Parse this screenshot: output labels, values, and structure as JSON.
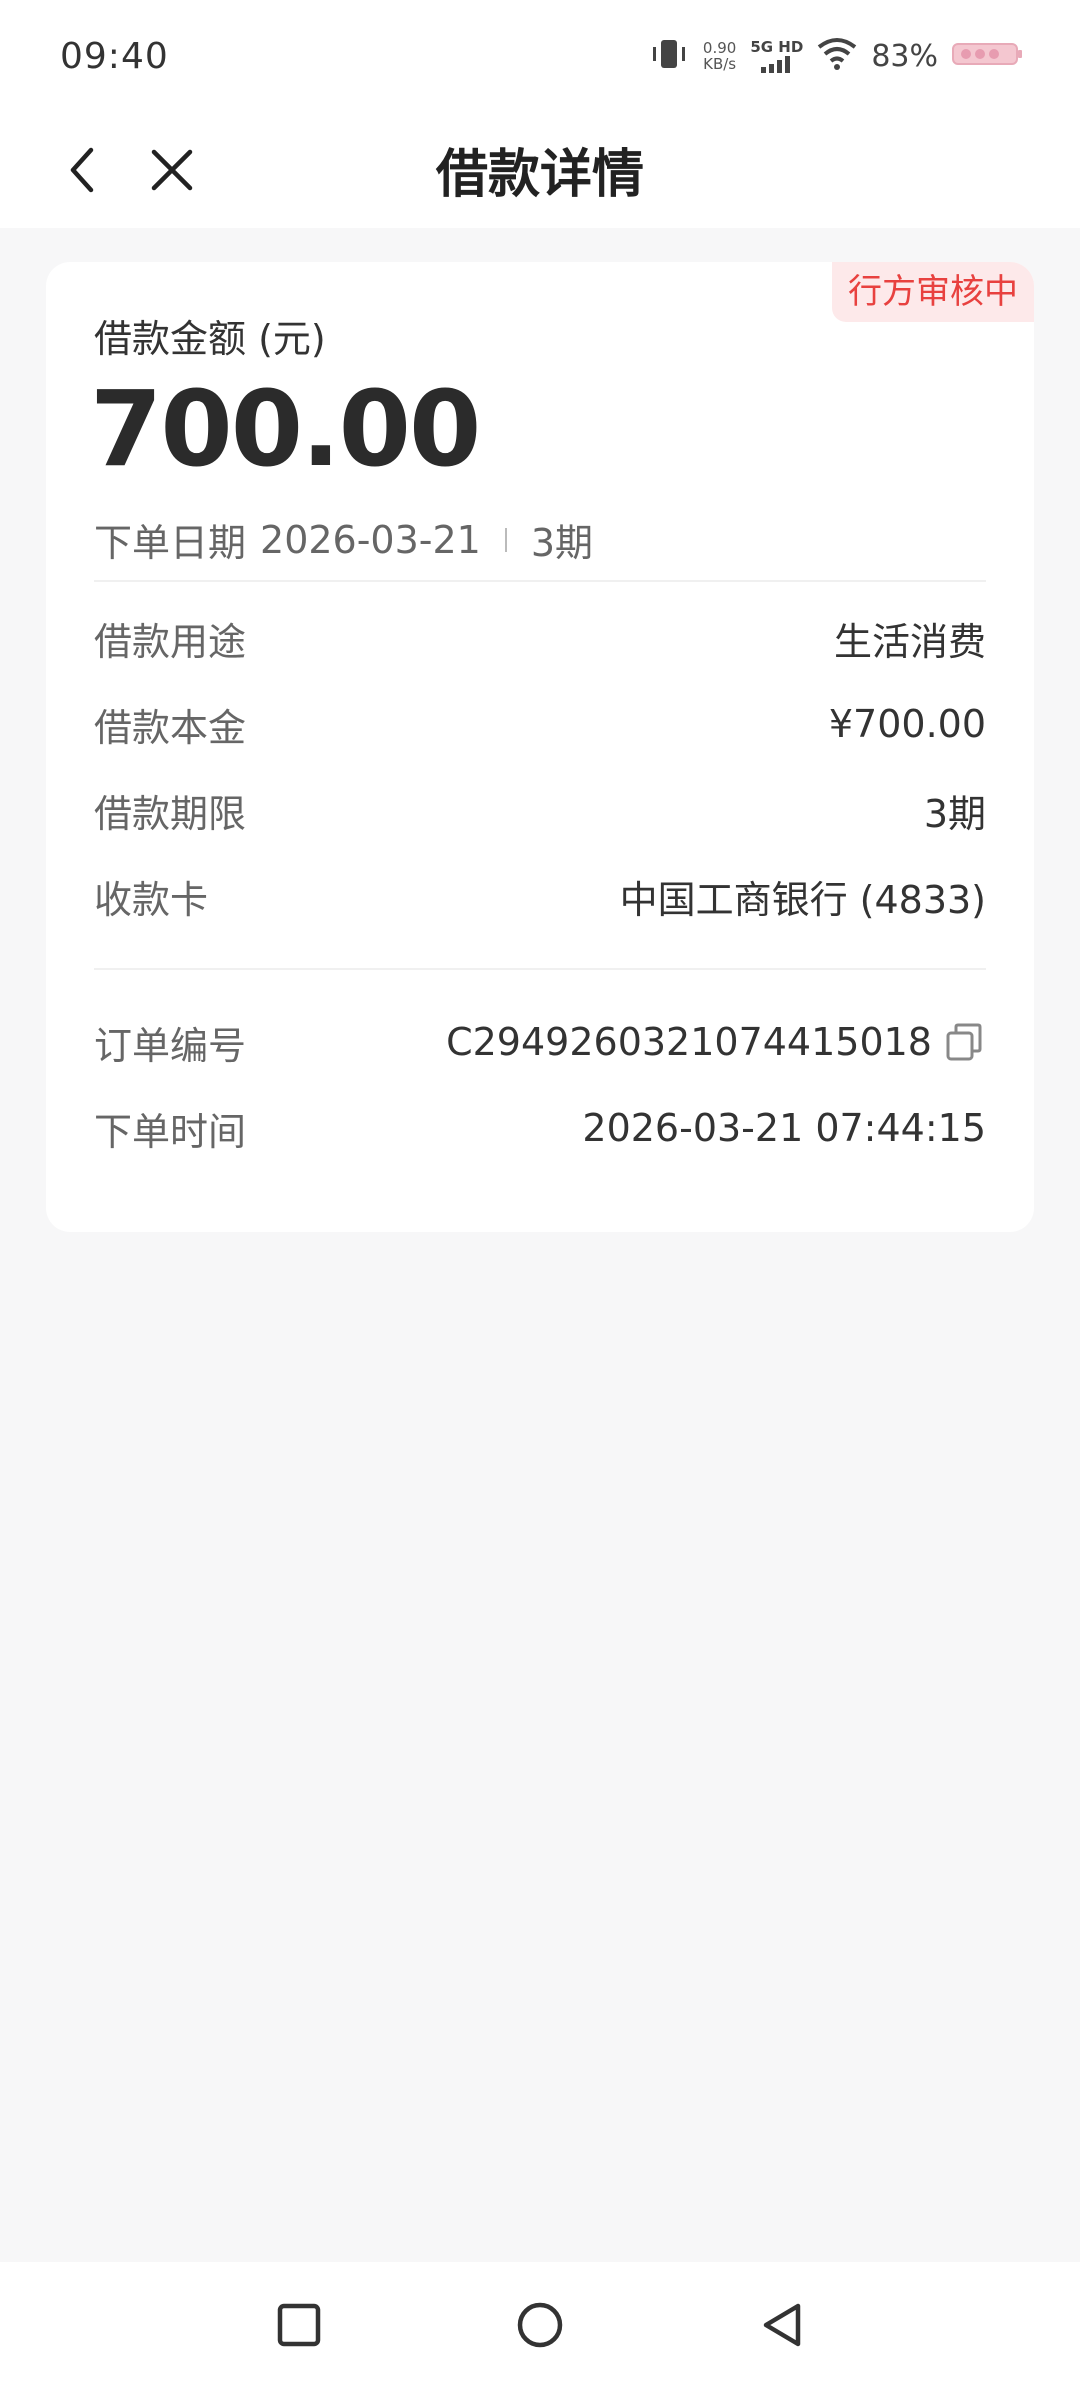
{
  "status_bar": {
    "time": "09:40",
    "net_speed_value": "0.90",
    "net_speed_unit": "KB/s",
    "network": "5G HD",
    "battery": "83%"
  },
  "header": {
    "title": "借款详情"
  },
  "card": {
    "status_tag": "行方审核中",
    "amount_label": "借款金额 (元)",
    "amount": "700.00",
    "order_date_label": "下单日期",
    "order_date": "2026-03-21",
    "periods": "3期",
    "rows": [
      {
        "label": "借款用途",
        "value": "生活消费"
      },
      {
        "label": "借款本金",
        "value": "¥700.00"
      },
      {
        "label": "借款期限",
        "value": "3期"
      },
      {
        "label": "收款卡",
        "value": "中国工商银行 (4833)"
      }
    ],
    "order_no_label": "订单编号",
    "order_no": "C2949260321074415018",
    "order_time_label": "下单时间",
    "order_time": "2026-03-21 07:44:15"
  },
  "colors": {
    "accent_red": "#e8413f",
    "tag_bg": "#fde9ea",
    "page_bg": "#f7f7f8"
  }
}
